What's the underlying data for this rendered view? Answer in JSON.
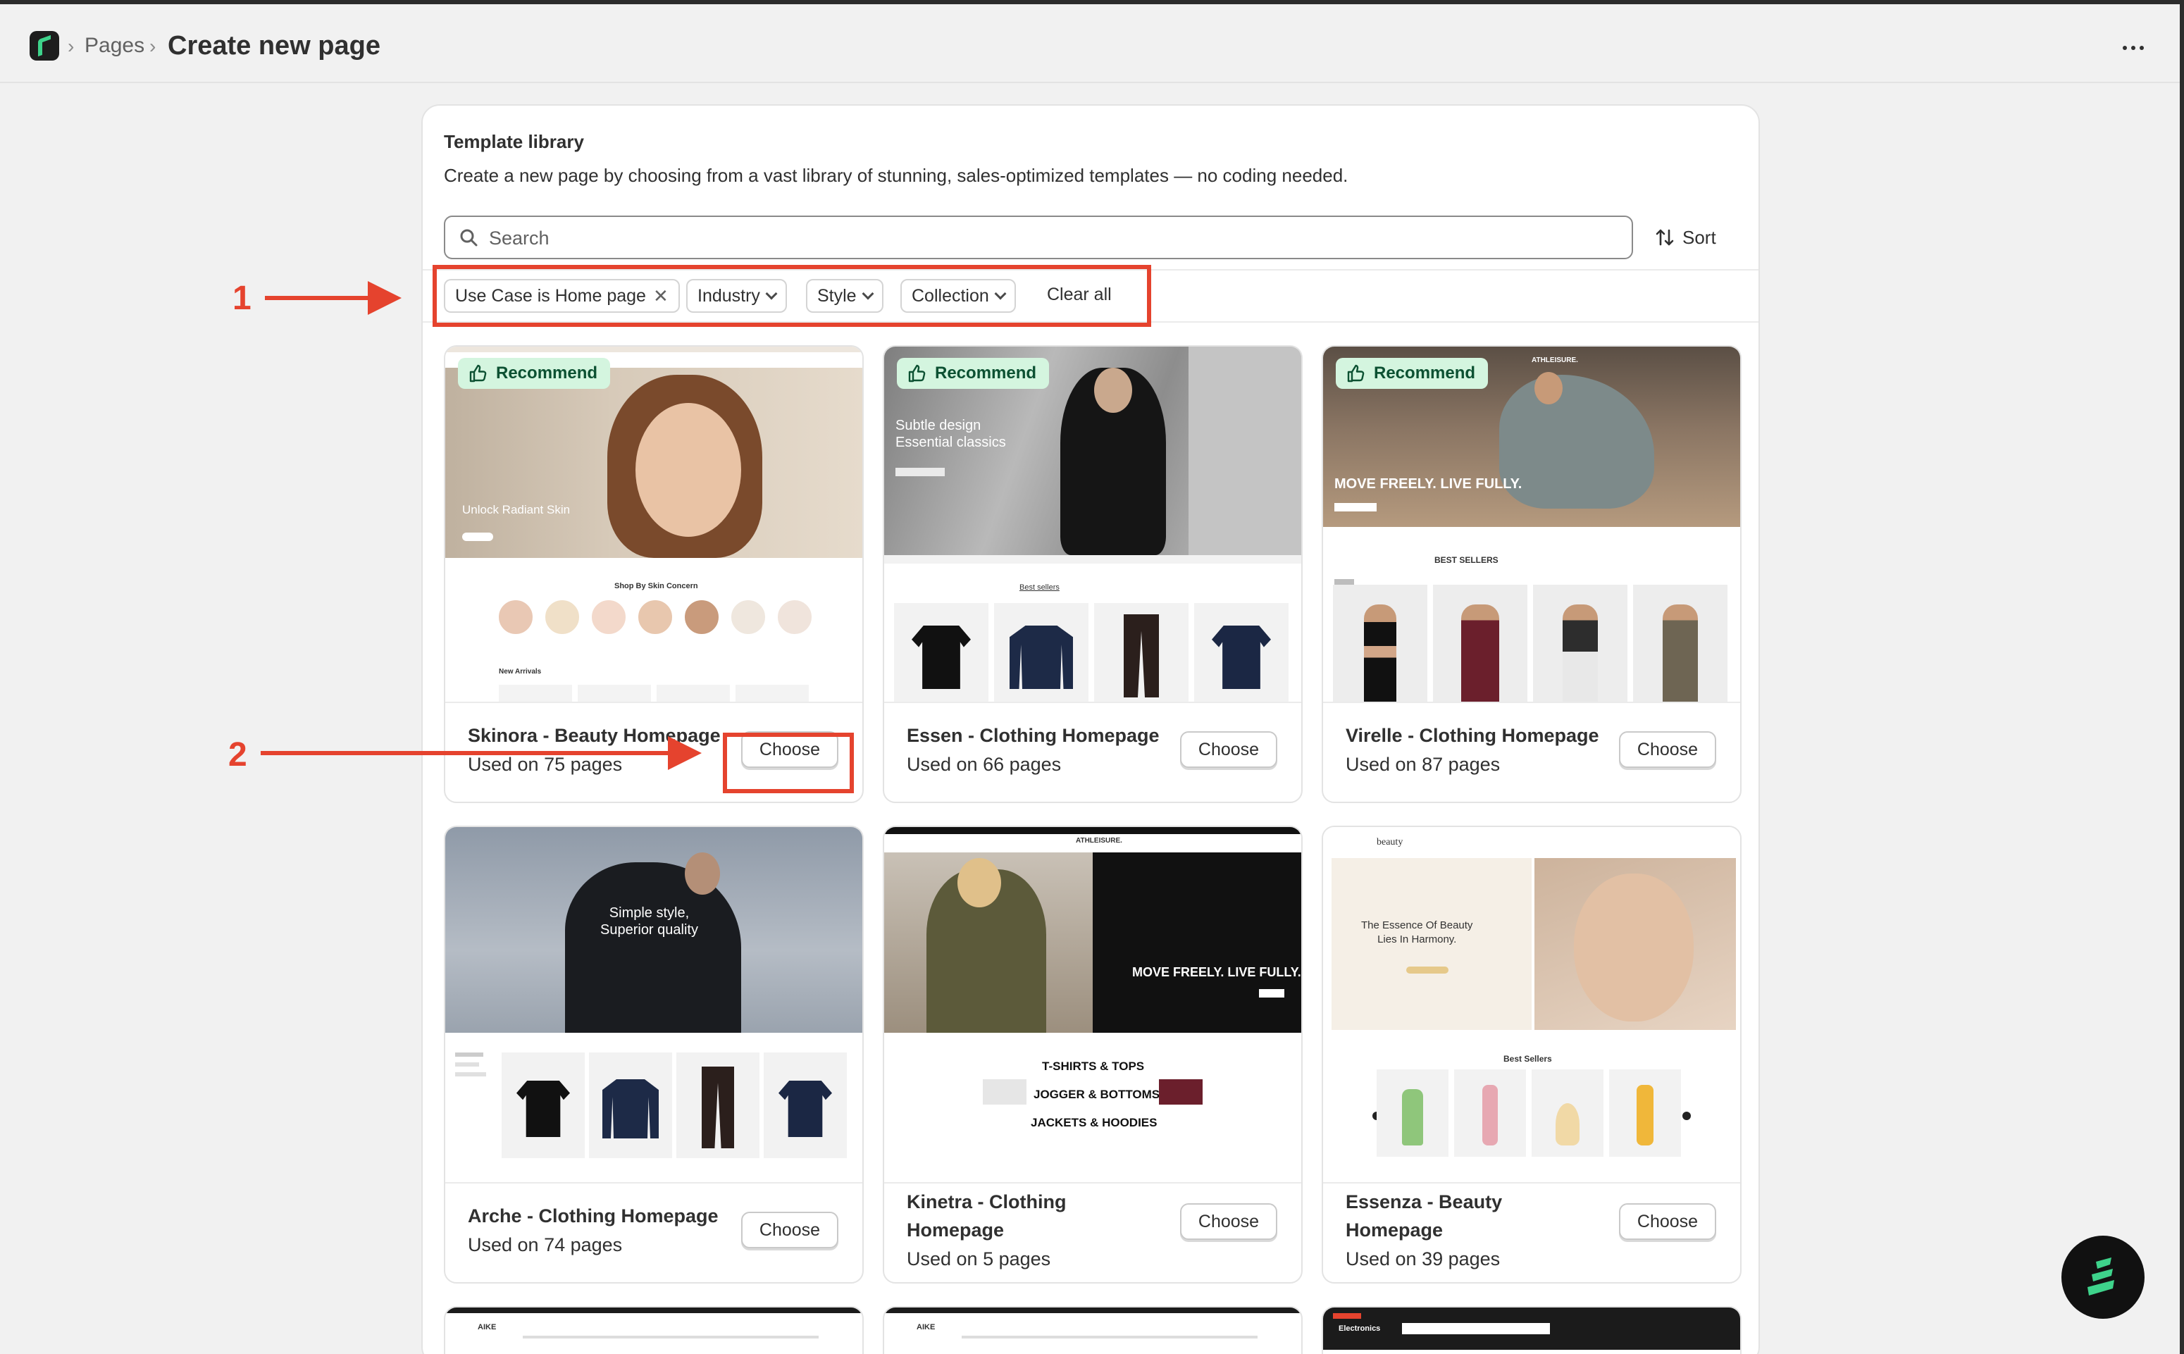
{
  "breadcrumb": {
    "section": "Pages",
    "current": "Create new page"
  },
  "library": {
    "title": "Template library",
    "description": "Create a new page by choosing from a vast library of stunning, sales-optimized templates — no coding needed."
  },
  "search": {
    "placeholder": "Search",
    "value": ""
  },
  "sort_label": "Sort",
  "filters": {
    "active": "Use Case is Home page",
    "dropdowns": [
      "Industry",
      "Style",
      "Collection"
    ],
    "clear_label": "Clear all"
  },
  "annotations": [
    "1",
    "2"
  ],
  "badge_label": "Recommend",
  "choose_label": "Choose",
  "templates": [
    {
      "name": "Skinora - Beauty Homepage",
      "used": "Used on 75 pages",
      "recommended": true,
      "thumb": {
        "hero": "Unlock Radiant Skin",
        "section": "Shop By Skin Concern",
        "section2": "New Arrivals"
      }
    },
    {
      "name": "Essen - Clothing Homepage",
      "used": "Used on 66 pages",
      "recommended": true,
      "thumb": {
        "hero": "Subtle design\nEssential classics",
        "section": "Best sellers"
      }
    },
    {
      "name": "Virelle - Clothing Homepage",
      "used": "Used on 87 pages",
      "recommended": true,
      "thumb": {
        "hero": "MOVE FREELY. LIVE FULLY.",
        "section": "BEST SELLERS",
        "brand": "ATHLEISURE."
      }
    },
    {
      "name": "Arche - Clothing Homepage",
      "used": "Used on 74 pages",
      "recommended": false,
      "thumb": {
        "hero": "Simple style,\nSuperior quality"
      }
    },
    {
      "name": "Kinetra - Clothing Homepage",
      "used": "Used on 5 pages",
      "recommended": false,
      "thumb": {
        "hero": "MOVE FREELY. LIVE FULLY.",
        "brand": "ATHLEISURE.",
        "lines": [
          "T-SHIRTS & TOPS",
          "JOGGER & BOTTOMS",
          "JACKETS & HOODIES"
        ]
      }
    },
    {
      "name": "Essenza - Beauty Homepage",
      "used": "Used on 39 pages",
      "recommended": false,
      "thumb": {
        "hero": "The Essence Of Beauty\nLies In Harmony.",
        "section": "Best Sellers",
        "brand": "beauty"
      }
    }
  ],
  "partial_row": [
    {
      "brand": "AIKE"
    },
    {
      "brand": "AIKE"
    },
    {
      "brand": "Electronics"
    }
  ],
  "colors": {
    "annotation": "#e5432e",
    "badge_bg": "#d4f5df",
    "badge_text": "#0c5132",
    "brand_green": "#3ed38b"
  }
}
